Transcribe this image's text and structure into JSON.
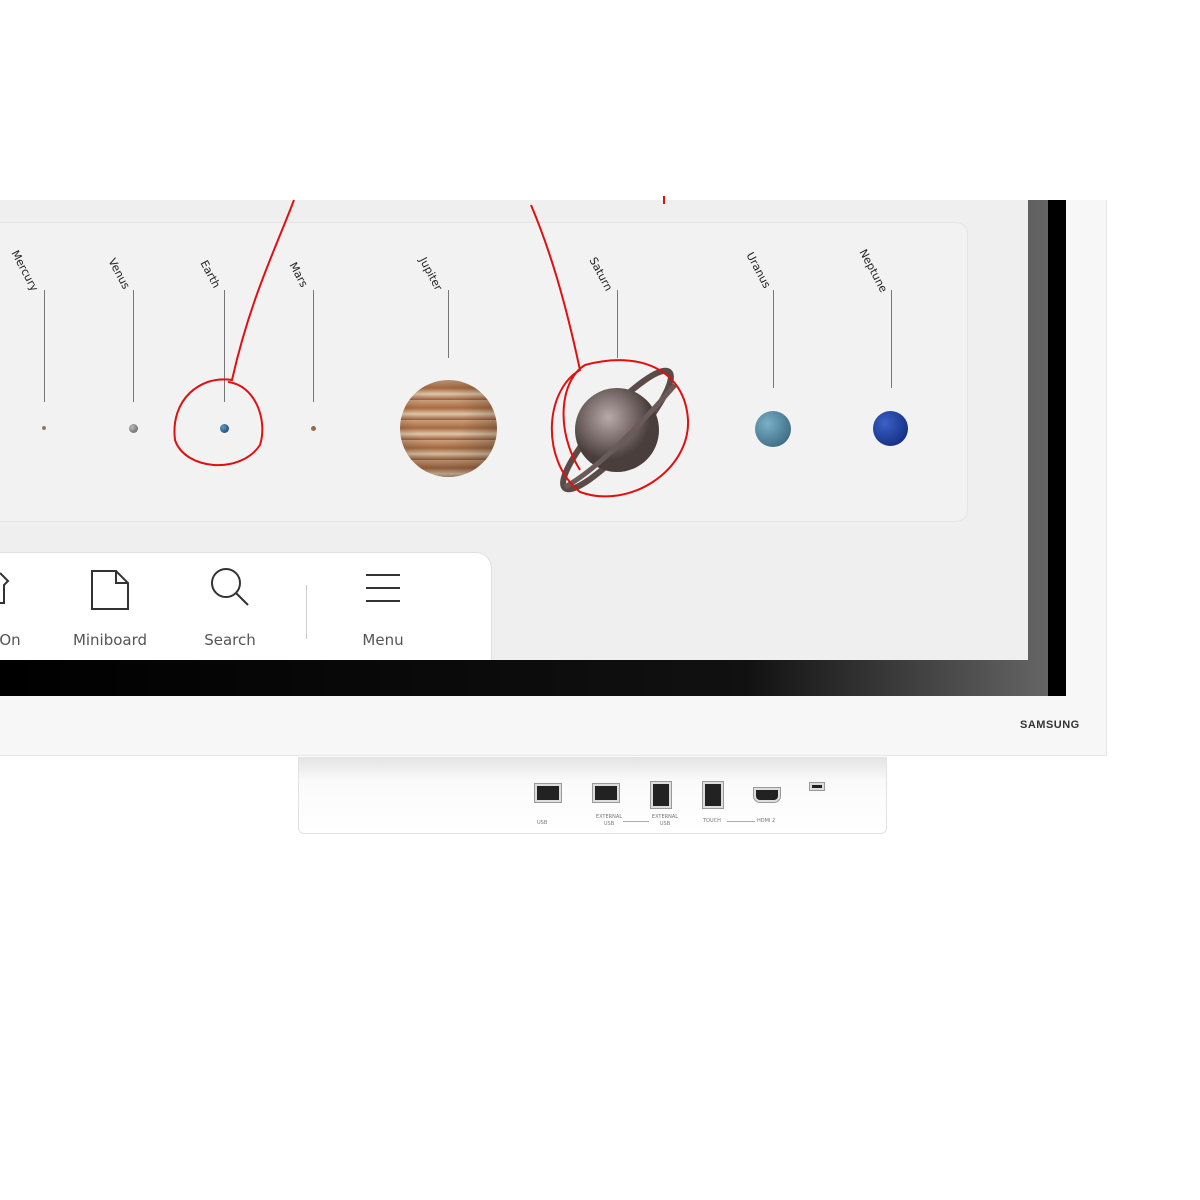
{
  "planets": [
    {
      "name": "Mercury",
      "color": "#8a7a6a"
    },
    {
      "name": "Venus",
      "color": "#888888"
    },
    {
      "name": "Earth",
      "color": "#1d4f7a"
    },
    {
      "name": "Mars",
      "color": "#9a6a4a"
    },
    {
      "name": "Jupiter",
      "color": "#b07a50"
    },
    {
      "name": "Saturn",
      "color": "#8a7a78"
    },
    {
      "name": "Uranus",
      "color": "#3f7590"
    },
    {
      "name": "Neptune",
      "color": "#1a3a90"
    }
  ],
  "toolbar": {
    "items": [
      {
        "label": "On",
        "icon": "screen-on-icon"
      },
      {
        "label": "Miniboard",
        "icon": "document-icon"
      },
      {
        "label": "Search",
        "icon": "search-icon"
      },
      {
        "label": "Menu",
        "icon": "hamburger-menu-icon"
      }
    ]
  },
  "brand": "SAMSUNG",
  "ports": [
    {
      "label": "USB"
    },
    {
      "label": "EXTERNAL USB"
    },
    {
      "label": "EXTERNAL USB"
    },
    {
      "label": "TOUCH"
    },
    {
      "label": "HDMI 2"
    },
    {
      "label": ""
    }
  ],
  "annotation_color": "#e01010"
}
